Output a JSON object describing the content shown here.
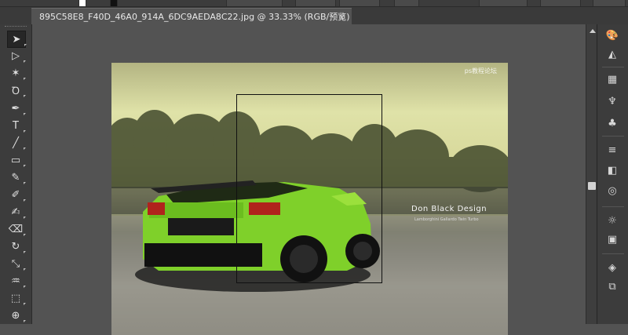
{
  "document_tab": {
    "title": "895C58E8_F40D_46A0_914A_6DC9AEDA8C22.jpg @ 33.33% (RGB/预览)",
    "close_glyph": "×"
  },
  "photo": {
    "watermark": "ps教程论坛",
    "brand": "Don Black Design",
    "brand_sub": "Lamborghini Gallardo Twin Turbo"
  },
  "tools": [
    {
      "name": "selection-tool-icon",
      "glyph": "➤"
    },
    {
      "name": "direct-selection-tool-icon",
      "glyph": "▷"
    },
    {
      "name": "magic-wand-tool-icon",
      "glyph": "✶"
    },
    {
      "name": "lasso-tool-icon",
      "glyph": "Ꝺ"
    },
    {
      "name": "pen-tool-icon",
      "glyph": "✒"
    },
    {
      "name": "type-tool-icon",
      "glyph": "T"
    },
    {
      "name": "line-segment-tool-icon",
      "glyph": "╱"
    },
    {
      "name": "rectangle-tool-icon",
      "glyph": "▭"
    },
    {
      "name": "paintbrush-tool-icon",
      "glyph": "✎"
    },
    {
      "name": "pencil-tool-icon",
      "glyph": "✐"
    },
    {
      "name": "blob-brush-tool-icon",
      "glyph": "✍"
    },
    {
      "name": "eraser-tool-icon",
      "glyph": "⌫"
    },
    {
      "name": "rotate-tool-icon",
      "glyph": "↻"
    },
    {
      "name": "scale-tool-icon",
      "glyph": "⤡"
    },
    {
      "name": "warp-tool-icon",
      "glyph": "♒"
    },
    {
      "name": "free-transform-tool-icon",
      "glyph": "⬚"
    },
    {
      "name": "shape-builder-tool-icon",
      "glyph": "⊕"
    }
  ],
  "panels": [
    {
      "name": "color-panel-icon",
      "glyph": "🎨"
    },
    {
      "name": "color-guide-icon",
      "glyph": "◭"
    },
    {
      "name": "swatches-panel-icon",
      "glyph": "▦"
    },
    {
      "name": "brushes-panel-icon",
      "glyph": "♆"
    },
    {
      "name": "symbols-panel-icon",
      "glyph": "♣"
    },
    {
      "name": "stroke-panel-icon",
      "glyph": "≡"
    },
    {
      "name": "gradient-panel-icon",
      "glyph": "◧"
    },
    {
      "name": "transparency-panel-icon",
      "glyph": "◎"
    },
    {
      "name": "appearance-panel-icon",
      "glyph": "☼"
    },
    {
      "name": "graphic-styles-icon",
      "glyph": "▣"
    },
    {
      "name": "layers-panel-icon",
      "glyph": "◈"
    },
    {
      "name": "artboards-panel-icon",
      "glyph": "⧉"
    }
  ],
  "colors": {
    "chrome": "#3c3c3c",
    "canvas": "#535353",
    "text": "#e8e8e8"
  }
}
